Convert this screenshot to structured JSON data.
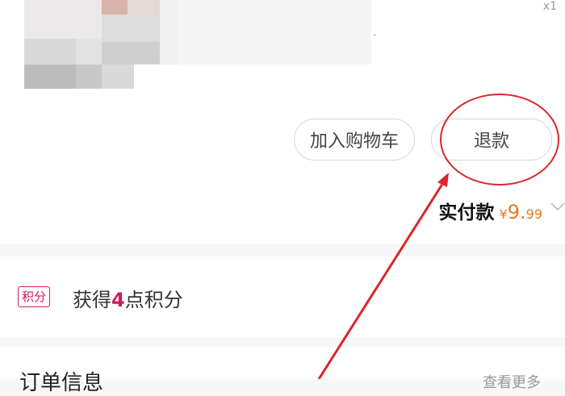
{
  "product": {
    "quantity": "x1"
  },
  "actions": {
    "add_to_cart_label": "加入购物车",
    "refund_label": "退款"
  },
  "payment": {
    "label": "实付款",
    "currency": "¥",
    "amount_int": "9.",
    "amount_dec": "99"
  },
  "points": {
    "badge": "积分",
    "text_before": "获得",
    "count": "4",
    "text_after": "点积分"
  },
  "order_info": {
    "title": "订单信息",
    "more": "查看更多"
  },
  "colors": {
    "price": "#e07a1f",
    "accent": "#d4185c",
    "annotation": "#d9262c"
  },
  "icons": {
    "chevron": "chevron-down-icon",
    "arrow": "annotation-arrow"
  }
}
